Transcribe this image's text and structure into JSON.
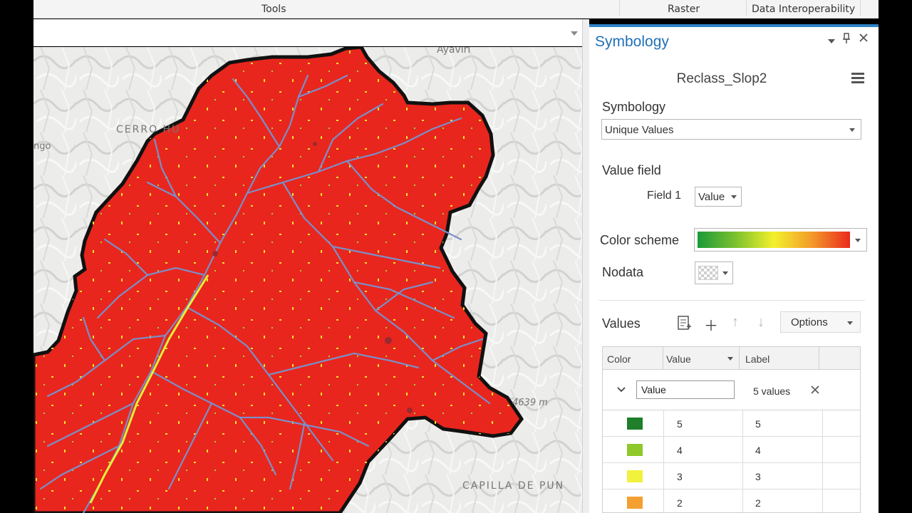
{
  "ribbon": {
    "tools": "Tools",
    "raster": "Raster",
    "data_interop": "Data Interoperability"
  },
  "map": {
    "labels": {
      "ayaviri": "Ayaviri",
      "cerro": "CERRO HU",
      "ngo": "ngo",
      "elevation": "4639 m",
      "capilla": "CAPILLA DE PUN"
    },
    "colors": {
      "watershed_fill": "#e8261e",
      "stream": "#7b8fc8",
      "boundary": "#111111"
    }
  },
  "pane": {
    "title": "Symbology",
    "icons": [
      "dropdown-icon",
      "pin-icon",
      "close-icon"
    ],
    "layer_name": "Reclass_Slop2",
    "symbology_label": "Symbology",
    "renderer": "Unique Values",
    "value_field_label": "Value field",
    "field1_label": "Field 1",
    "field1_value": "Value",
    "color_scheme_label": "Color scheme",
    "nodata_label": "Nodata",
    "values_label": "Values",
    "options_label": "Options",
    "grid": {
      "headers": [
        "Color",
        "Value",
        "Label"
      ],
      "group_field": "Value",
      "group_count": "5 values",
      "rows": [
        {
          "color": "#1f7f2a",
          "value": "5",
          "label": "5"
        },
        {
          "color": "#8fc82b",
          "value": "4",
          "label": "4"
        },
        {
          "color": "#f0f23c",
          "value": "3",
          "label": "3"
        },
        {
          "color": "#f3a030",
          "value": "2",
          "label": "2"
        }
      ]
    }
  }
}
